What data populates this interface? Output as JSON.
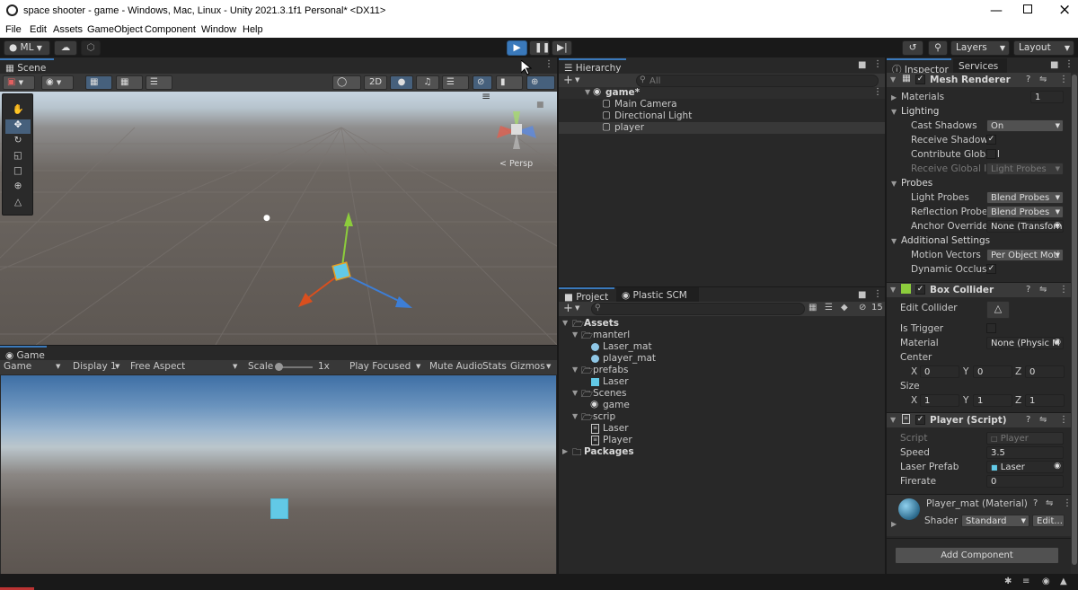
{
  "window": {
    "title": "space shooter - game - Windows, Mac, Linux - Unity 2021.3.1f1 Personal* <DX11>"
  },
  "menu": [
    "File",
    "Edit",
    "Assets",
    "GameObject",
    "Component",
    "Window",
    "Help"
  ],
  "toolbar": {
    "account": "ML",
    "layers": "Layers",
    "layout": "Layout"
  },
  "scene": {
    "tab": "Scene",
    "mode_2d": "2D",
    "persp": "< Persp"
  },
  "game": {
    "tab": "Game",
    "display_mode": "Game",
    "display": "Display 1",
    "aspect": "Free Aspect",
    "scale_label": "Scale",
    "scale_value": "1x",
    "play_focused": "Play Focused",
    "mute_audio": "Mute Audio",
    "stats": "Stats",
    "gizmos": "Gizmos"
  },
  "hierarchy": {
    "tab": "Hierarchy",
    "search_placeholder": "All",
    "root": "game*",
    "items": [
      "Main Camera",
      "Directional Light",
      "player"
    ]
  },
  "project": {
    "tabs": [
      "Project",
      "Plastic SCM"
    ],
    "hidden_count": "15",
    "tree": [
      {
        "label": "Assets",
        "indent": 0,
        "kind": "folder-open",
        "bold": true
      },
      {
        "label": "manterl",
        "indent": 1,
        "kind": "folder-open"
      },
      {
        "label": "Laser_mat",
        "indent": 2,
        "kind": "material"
      },
      {
        "label": "player_mat",
        "indent": 2,
        "kind": "material"
      },
      {
        "label": "prefabs",
        "indent": 1,
        "kind": "folder-open"
      },
      {
        "label": "Laser",
        "indent": 2,
        "kind": "prefab"
      },
      {
        "label": "Scenes",
        "indent": 1,
        "kind": "folder-open"
      },
      {
        "label": "game",
        "indent": 2,
        "kind": "scene"
      },
      {
        "label": "scrip",
        "indent": 1,
        "kind": "folder-open"
      },
      {
        "label": "Laser",
        "indent": 2,
        "kind": "script"
      },
      {
        "label": "Player",
        "indent": 2,
        "kind": "script"
      },
      {
        "label": "Packages",
        "indent": 0,
        "kind": "folder",
        "bold": true
      }
    ]
  },
  "inspector": {
    "tabs": [
      "Inspector",
      "Services"
    ],
    "mesh_renderer": {
      "title": "Mesh Renderer",
      "materials_label": "Materials",
      "materials_value": "1",
      "lighting": "Lighting",
      "cast_shadows_label": "Cast Shadows",
      "cast_shadows_value": "On",
      "receive_shadows_label": "Receive Shadows",
      "contribute_gi_label": "Contribute Global I",
      "receive_gi_label": "Receive Global Illu",
      "receive_gi_value": "Light Probes",
      "probes": "Probes",
      "light_probes_label": "Light Probes",
      "light_probes_value": "Blend Probes",
      "reflection_probes_label": "Reflection Probes",
      "reflection_probes_value": "Blend Probes",
      "anchor_override_label": "Anchor Override",
      "anchor_override_value": "None (Transforn",
      "additional": "Additional Settings",
      "motion_vectors_label": "Motion Vectors",
      "motion_vectors_value": "Per Object Moti",
      "dynamic_occlusion_label": "Dynamic Occlusio"
    },
    "box_collider": {
      "title": "Box Collider",
      "edit_collider_label": "Edit Collider",
      "is_trigger_label": "Is Trigger",
      "material_label": "Material",
      "material_value": "None (Physic M",
      "center_label": "Center",
      "center": {
        "x": "0",
        "y": "0",
        "z": "0"
      },
      "size_label": "Size",
      "size": {
        "x": "1",
        "y": "1",
        "z": "1"
      }
    },
    "player_script": {
      "title": "Player (Script)",
      "script_label": "Script",
      "script_value": "Player",
      "speed_label": "Speed",
      "speed_value": "3.5",
      "laser_prefab_label": "Laser Prefab",
      "laser_prefab_value": "Laser",
      "firerate_label": "Firerate",
      "firerate_value": "0"
    },
    "material": {
      "title": "Player_mat (Material)",
      "shader_label": "Shader",
      "shader_value": "Standard",
      "edit": "Edit..."
    },
    "add_component": "Add Component"
  },
  "axis_labels": {
    "x": "X",
    "y": "Y",
    "z": "Z"
  },
  "colors": {
    "accent_blue": "#3a79bb",
    "selected_row": "#2c5d87",
    "cube": "#62c9e6"
  }
}
